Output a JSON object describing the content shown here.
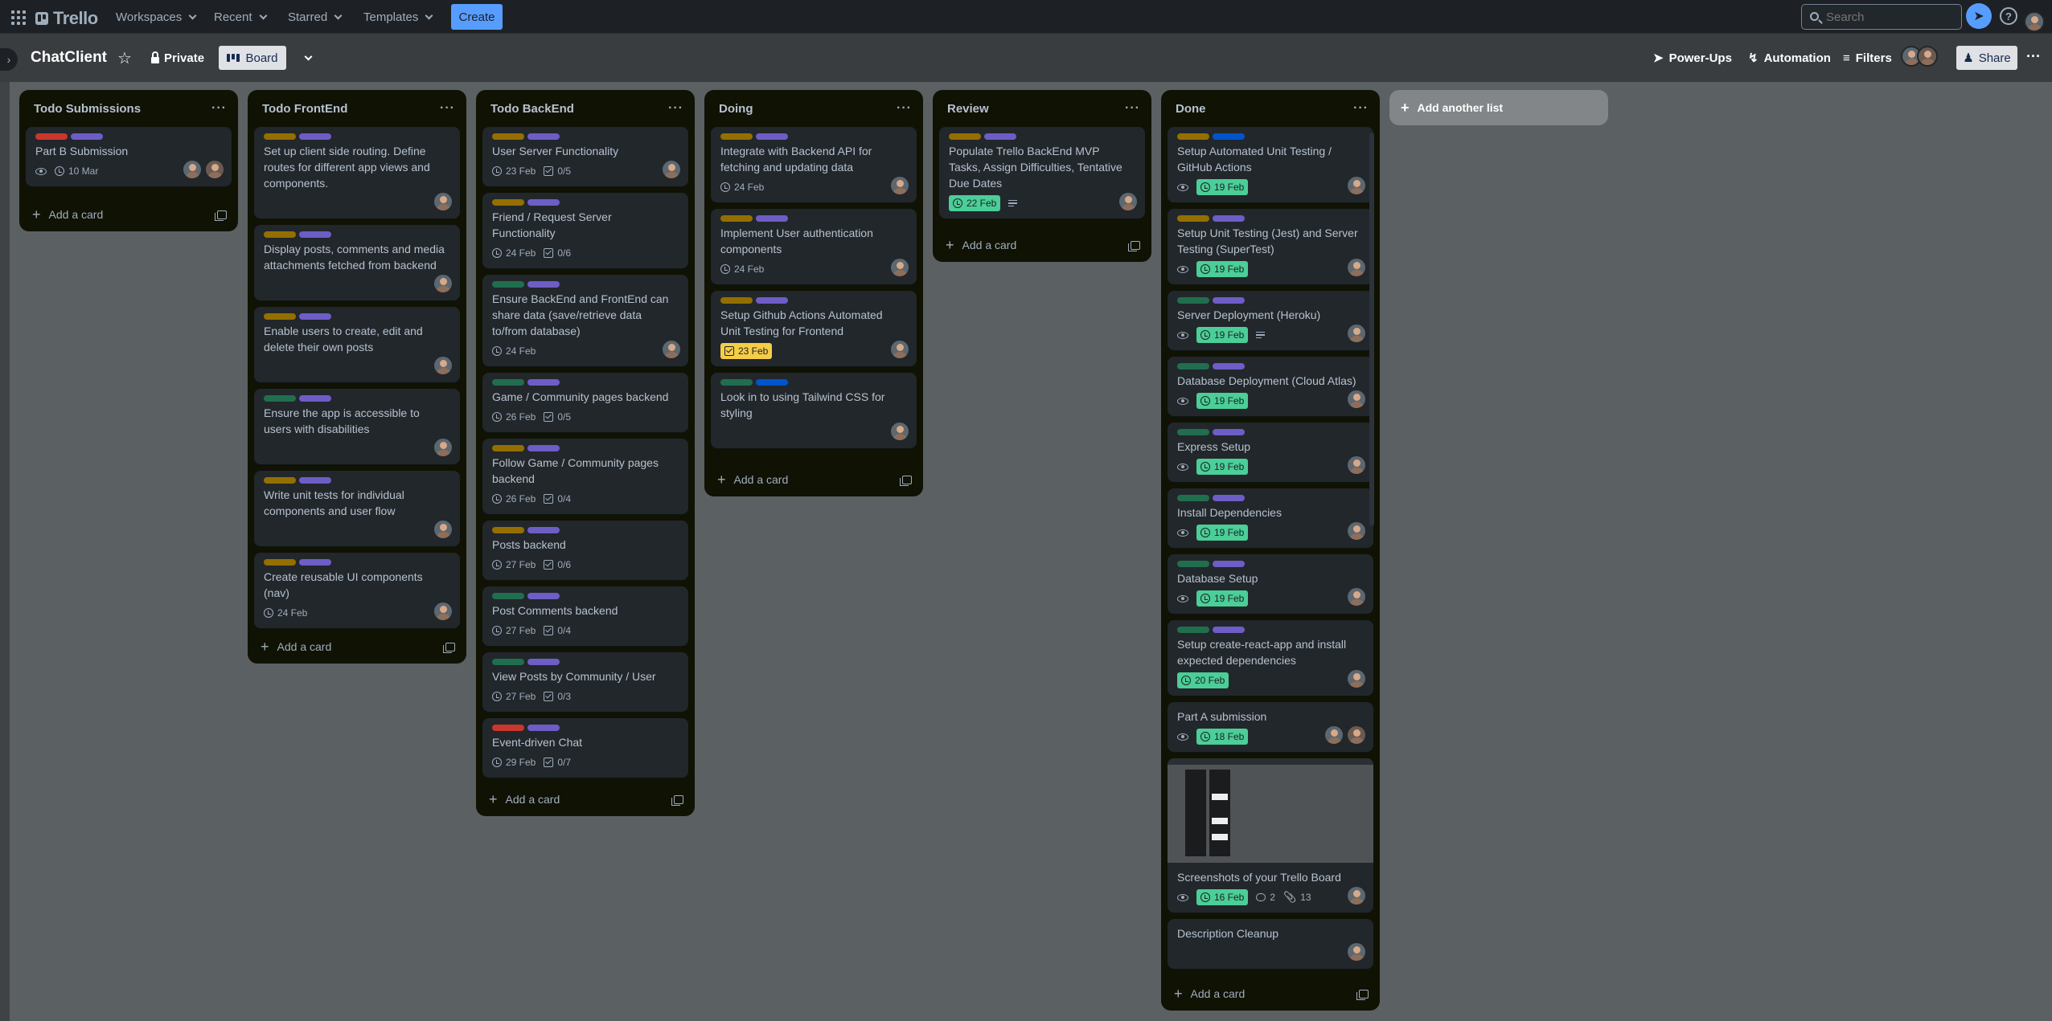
{
  "nav": {
    "logo": "Trello",
    "menus": [
      "Workspaces",
      "Recent",
      "Starred",
      "Templates"
    ],
    "create": "Create",
    "search_placeholder": "Search",
    "help": "?"
  },
  "board": {
    "title": "ChatClient",
    "visibility": "Private",
    "view": "Board",
    "power_ups": "Power-Ups",
    "automation": "Automation",
    "filters": "Filters",
    "share": "Share",
    "more": "···"
  },
  "colors": {
    "yellow": "#946f00",
    "purple": "#6e5dc6",
    "red": "#c9372c",
    "green": "#216e4e",
    "blue": "#0055cc",
    "due_complete": "#4bce97",
    "due_soon": "#f5cd47",
    "accent": "#579dff"
  },
  "add_card": "Add a card",
  "add_list": "Add another list",
  "lists": [
    {
      "title": "Todo Submissions",
      "cards": [
        {
          "title": "Part B Submission",
          "labels": [
            "red",
            "purple"
          ],
          "watch": true,
          "date": "10 Mar",
          "members": 2
        }
      ]
    },
    {
      "title": "Todo FrontEnd",
      "cards": [
        {
          "title": "Set up client side routing. Define routes for different app views and components.",
          "labels": [
            "yellow",
            "purple"
          ],
          "members": 1
        },
        {
          "title": "Display posts, comments and media attachments fetched from backend",
          "labels": [
            "yellow",
            "purple"
          ],
          "members": 1
        },
        {
          "title": "Enable users to create, edit and delete their own posts",
          "labels": [
            "yellow",
            "purple"
          ],
          "members": 1
        },
        {
          "title": "Ensure the app is accessible to users with disabilities",
          "labels": [
            "green",
            "purple"
          ],
          "members": 1
        },
        {
          "title": "Write unit tests for individual components and user flow",
          "labels": [
            "yellow",
            "purple"
          ],
          "members": 1
        },
        {
          "title": "Create reusable UI components (nav)",
          "labels": [
            "yellow",
            "purple"
          ],
          "date": "24 Feb",
          "members": 1
        }
      ]
    },
    {
      "title": "Todo BackEnd",
      "cards": [
        {
          "title": "User Server Functionality",
          "labels": [
            "yellow",
            "purple"
          ],
          "date": "23 Feb",
          "checklist": "0/5",
          "members": 1
        },
        {
          "title": "Friend / Request Server Functionality",
          "labels": [
            "yellow",
            "purple"
          ],
          "date": "24 Feb",
          "checklist": "0/6"
        },
        {
          "title": "Ensure BackEnd and FrontEnd can share data (save/retrieve data to/from database)",
          "labels": [
            "green",
            "purple"
          ],
          "date": "24 Feb",
          "members": 1
        },
        {
          "title": "Game / Community pages backend",
          "labels": [
            "green",
            "purple"
          ],
          "date": "26 Feb",
          "checklist": "0/5"
        },
        {
          "title": "Follow Game / Community pages backend",
          "labels": [
            "yellow",
            "purple"
          ],
          "date": "26 Feb",
          "checklist": "0/4"
        },
        {
          "title": "Posts backend",
          "labels": [
            "yellow",
            "purple"
          ],
          "date": "27 Feb",
          "checklist": "0/6"
        },
        {
          "title": "Post Comments backend",
          "labels": [
            "green",
            "purple"
          ],
          "date": "27 Feb",
          "checklist": "0/4"
        },
        {
          "title": "View Posts by Community / User",
          "labels": [
            "green",
            "purple"
          ],
          "date": "27 Feb",
          "checklist": "0/3"
        },
        {
          "title": "Event-driven Chat",
          "labels": [
            "red",
            "purple"
          ],
          "date": "29 Feb",
          "checklist": "0/7"
        }
      ]
    },
    {
      "title": "Doing",
      "cards": [
        {
          "title": "Integrate with Backend API for fetching and updating data",
          "labels": [
            "yellow",
            "purple"
          ],
          "date": "24 Feb",
          "members": 1
        },
        {
          "title": "Implement User authentication components",
          "labels": [
            "yellow",
            "purple"
          ],
          "date": "24 Feb",
          "members": 1
        },
        {
          "title": "Setup Github Actions Automated Unit Testing for Frontend",
          "labels": [
            "yellow",
            "purple"
          ],
          "date": "23 Feb",
          "date_style": "soon",
          "members": 1
        },
        {
          "title": "Look in to using Tailwind CSS for styling",
          "labels": [
            "green",
            "blue"
          ],
          "members": 1
        }
      ]
    },
    {
      "title": "Review",
      "cards": [
        {
          "title": "Populate Trello BackEnd MVP Tasks, Assign Difficulties, Tentative Due Dates",
          "labels": [
            "yellow",
            "purple"
          ],
          "date": "22 Feb",
          "date_style": "done",
          "description": true,
          "members": 1
        }
      ]
    },
    {
      "title": "Done",
      "cards": [
        {
          "title": "Setup Automated Unit Testing / GitHub Actions",
          "labels": [
            "yellow",
            "blue"
          ],
          "watch": true,
          "date": "19 Feb",
          "date_style": "done",
          "members": 1
        },
        {
          "title": "Setup Unit Testing (Jest) and Server Testing (SuperTest)",
          "labels": [
            "yellow",
            "purple"
          ],
          "watch": true,
          "date": "19 Feb",
          "date_style": "done",
          "members": 1
        },
        {
          "title": "Server Deployment (Heroku)",
          "labels": [
            "green",
            "purple"
          ],
          "watch": true,
          "date": "19 Feb",
          "date_style": "done",
          "description": true,
          "members": 1
        },
        {
          "title": "Database Deployment (Cloud Atlas)",
          "labels": [
            "green",
            "purple"
          ],
          "watch": true,
          "date": "19 Feb",
          "date_style": "done",
          "members": 1
        },
        {
          "title": "Express Setup",
          "labels": [
            "green",
            "purple"
          ],
          "watch": true,
          "date": "19 Feb",
          "date_style": "done",
          "members": 1
        },
        {
          "title": "Install Dependencies",
          "labels": [
            "green",
            "purple"
          ],
          "watch": true,
          "date": "19 Feb",
          "date_style": "done",
          "members": 1
        },
        {
          "title": "Database Setup",
          "labels": [
            "green",
            "purple"
          ],
          "watch": true,
          "date": "19 Feb",
          "date_style": "done",
          "members": 1
        },
        {
          "title": "Setup create-react-app and install expected dependencies",
          "labels": [
            "green",
            "purple"
          ],
          "date": "20 Feb",
          "date_style": "done",
          "members": 1
        },
        {
          "title": "Part A submission",
          "labels": [],
          "watch": true,
          "date": "18 Feb",
          "date_style": "done",
          "members": 2
        },
        {
          "title": "Screenshots of your Trello Board",
          "labels": [],
          "cover": true,
          "watch": true,
          "date": "16 Feb",
          "date_style": "done",
          "comments": "2",
          "attachments": "13",
          "members": 1
        },
        {
          "title": "Description Cleanup",
          "labels": [],
          "members": 1
        }
      ]
    }
  ]
}
